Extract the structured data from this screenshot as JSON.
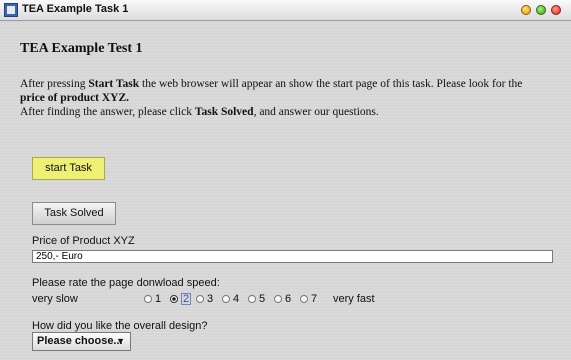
{
  "window": {
    "title": "TEA Example Task 1"
  },
  "page": {
    "heading": "TEA Example Test 1",
    "intro_line1_a": "After pressing ",
    "intro_line1_b": "Start Task",
    "intro_line1_c": " the web browser will appear an show the start page of this task. Please look for the ",
    "intro_line1_d": "price of product XYZ.",
    "intro_line2_a": "After finding the answer, please click ",
    "intro_line2_b": "Task Solved",
    "intro_line2_c": ", and answer our questions.",
    "start_button": "start Task",
    "solved_button": "Task Solved",
    "price_label": "Price of Product XYZ",
    "price_value": "250,- Euro",
    "speed_label": "Please rate the page donwload speed:",
    "speed_low": "very slow",
    "speed_high": "very fast",
    "speed_options": [
      "1",
      "2",
      "3",
      "4",
      "5",
      "6",
      "7"
    ],
    "speed_selected": "2",
    "design_label": "How did you like the overall design?",
    "design_select": "Please choose...",
    "colors": {
      "start_button_bg": "#eef073"
    }
  }
}
